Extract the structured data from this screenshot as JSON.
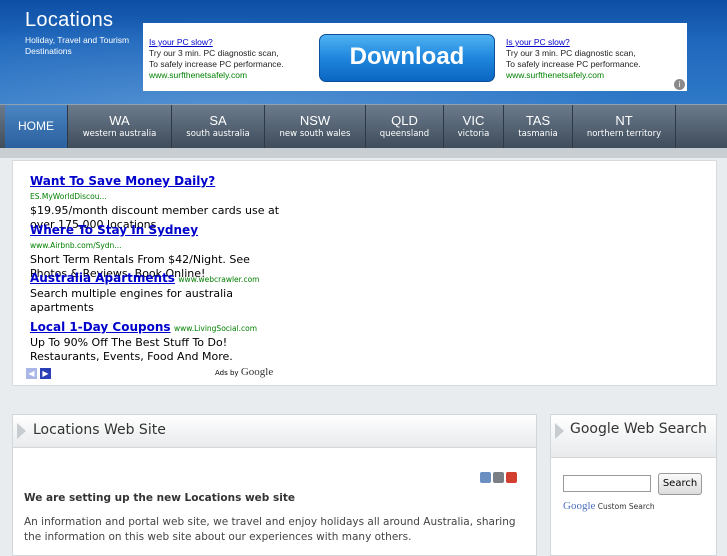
{
  "site": {
    "title": "Locations",
    "tagline": "Holiday, Travel and Tourism Destinations"
  },
  "banner_ad": {
    "left": {
      "question": "Is your PC slow?",
      "line1": "Try our 3 min. PC diagnostic scan,",
      "line2": "To safely increase PC performance.",
      "url": "www.surfthenetsafely.com"
    },
    "button": "Download",
    "right": {
      "question": "Is your PC slow?",
      "line1": "Try our 3 min. PC diagnostic scan,",
      "line2": "To safely increase PC performance.",
      "url": "www.surfthenetsafely.com"
    }
  },
  "nav": {
    "home": "HOME",
    "items": [
      {
        "abbr": "WA",
        "name": "western australia"
      },
      {
        "abbr": "SA",
        "name": "south australia"
      },
      {
        "abbr": "NSW",
        "name": "new south wales"
      },
      {
        "abbr": "QLD",
        "name": "queensland"
      },
      {
        "abbr": "VIC",
        "name": "victoria"
      },
      {
        "abbr": "TAS",
        "name": "tasmania"
      },
      {
        "abbr": "NT",
        "name": "northern territory"
      }
    ]
  },
  "text_ads": [
    {
      "title": "Want To Save Money Daily?",
      "url": "ES.MyWorldDiscou...",
      "body": "$19.95/month discount member cards use at over 175,000 locations"
    },
    {
      "title": "Where To Stay In Sydney",
      "url": "www.Airbnb.com/Sydn...",
      "body": "Short Term Rentals From $42/Night. See Photos & Reviews. Book Online!"
    },
    {
      "title": "Australia Apartments",
      "url": "www.webcrawler.com",
      "body": "Search multiple engines for australia apartments"
    },
    {
      "title": "Local 1-Day Coupons",
      "url": "www.LivingSocial.com",
      "body": "Up To 90% Off The Best Stuff To Do! Restaurants, Events, Food And More."
    }
  ],
  "ads_by": {
    "prefix": "Ads by",
    "brand": "Google"
  },
  "content": {
    "title": "Locations Web Site",
    "heading": "We are setting up the new Locations web site",
    "paragraph": "An information and portal web site, we travel and enjoy holidays all around Australia, sharing the information on this web site about our experiences with many others."
  },
  "sidebar": {
    "title": "Google Web Search",
    "search_button": "Search",
    "google_label": "Google",
    "custom_search": "Custom Search"
  }
}
